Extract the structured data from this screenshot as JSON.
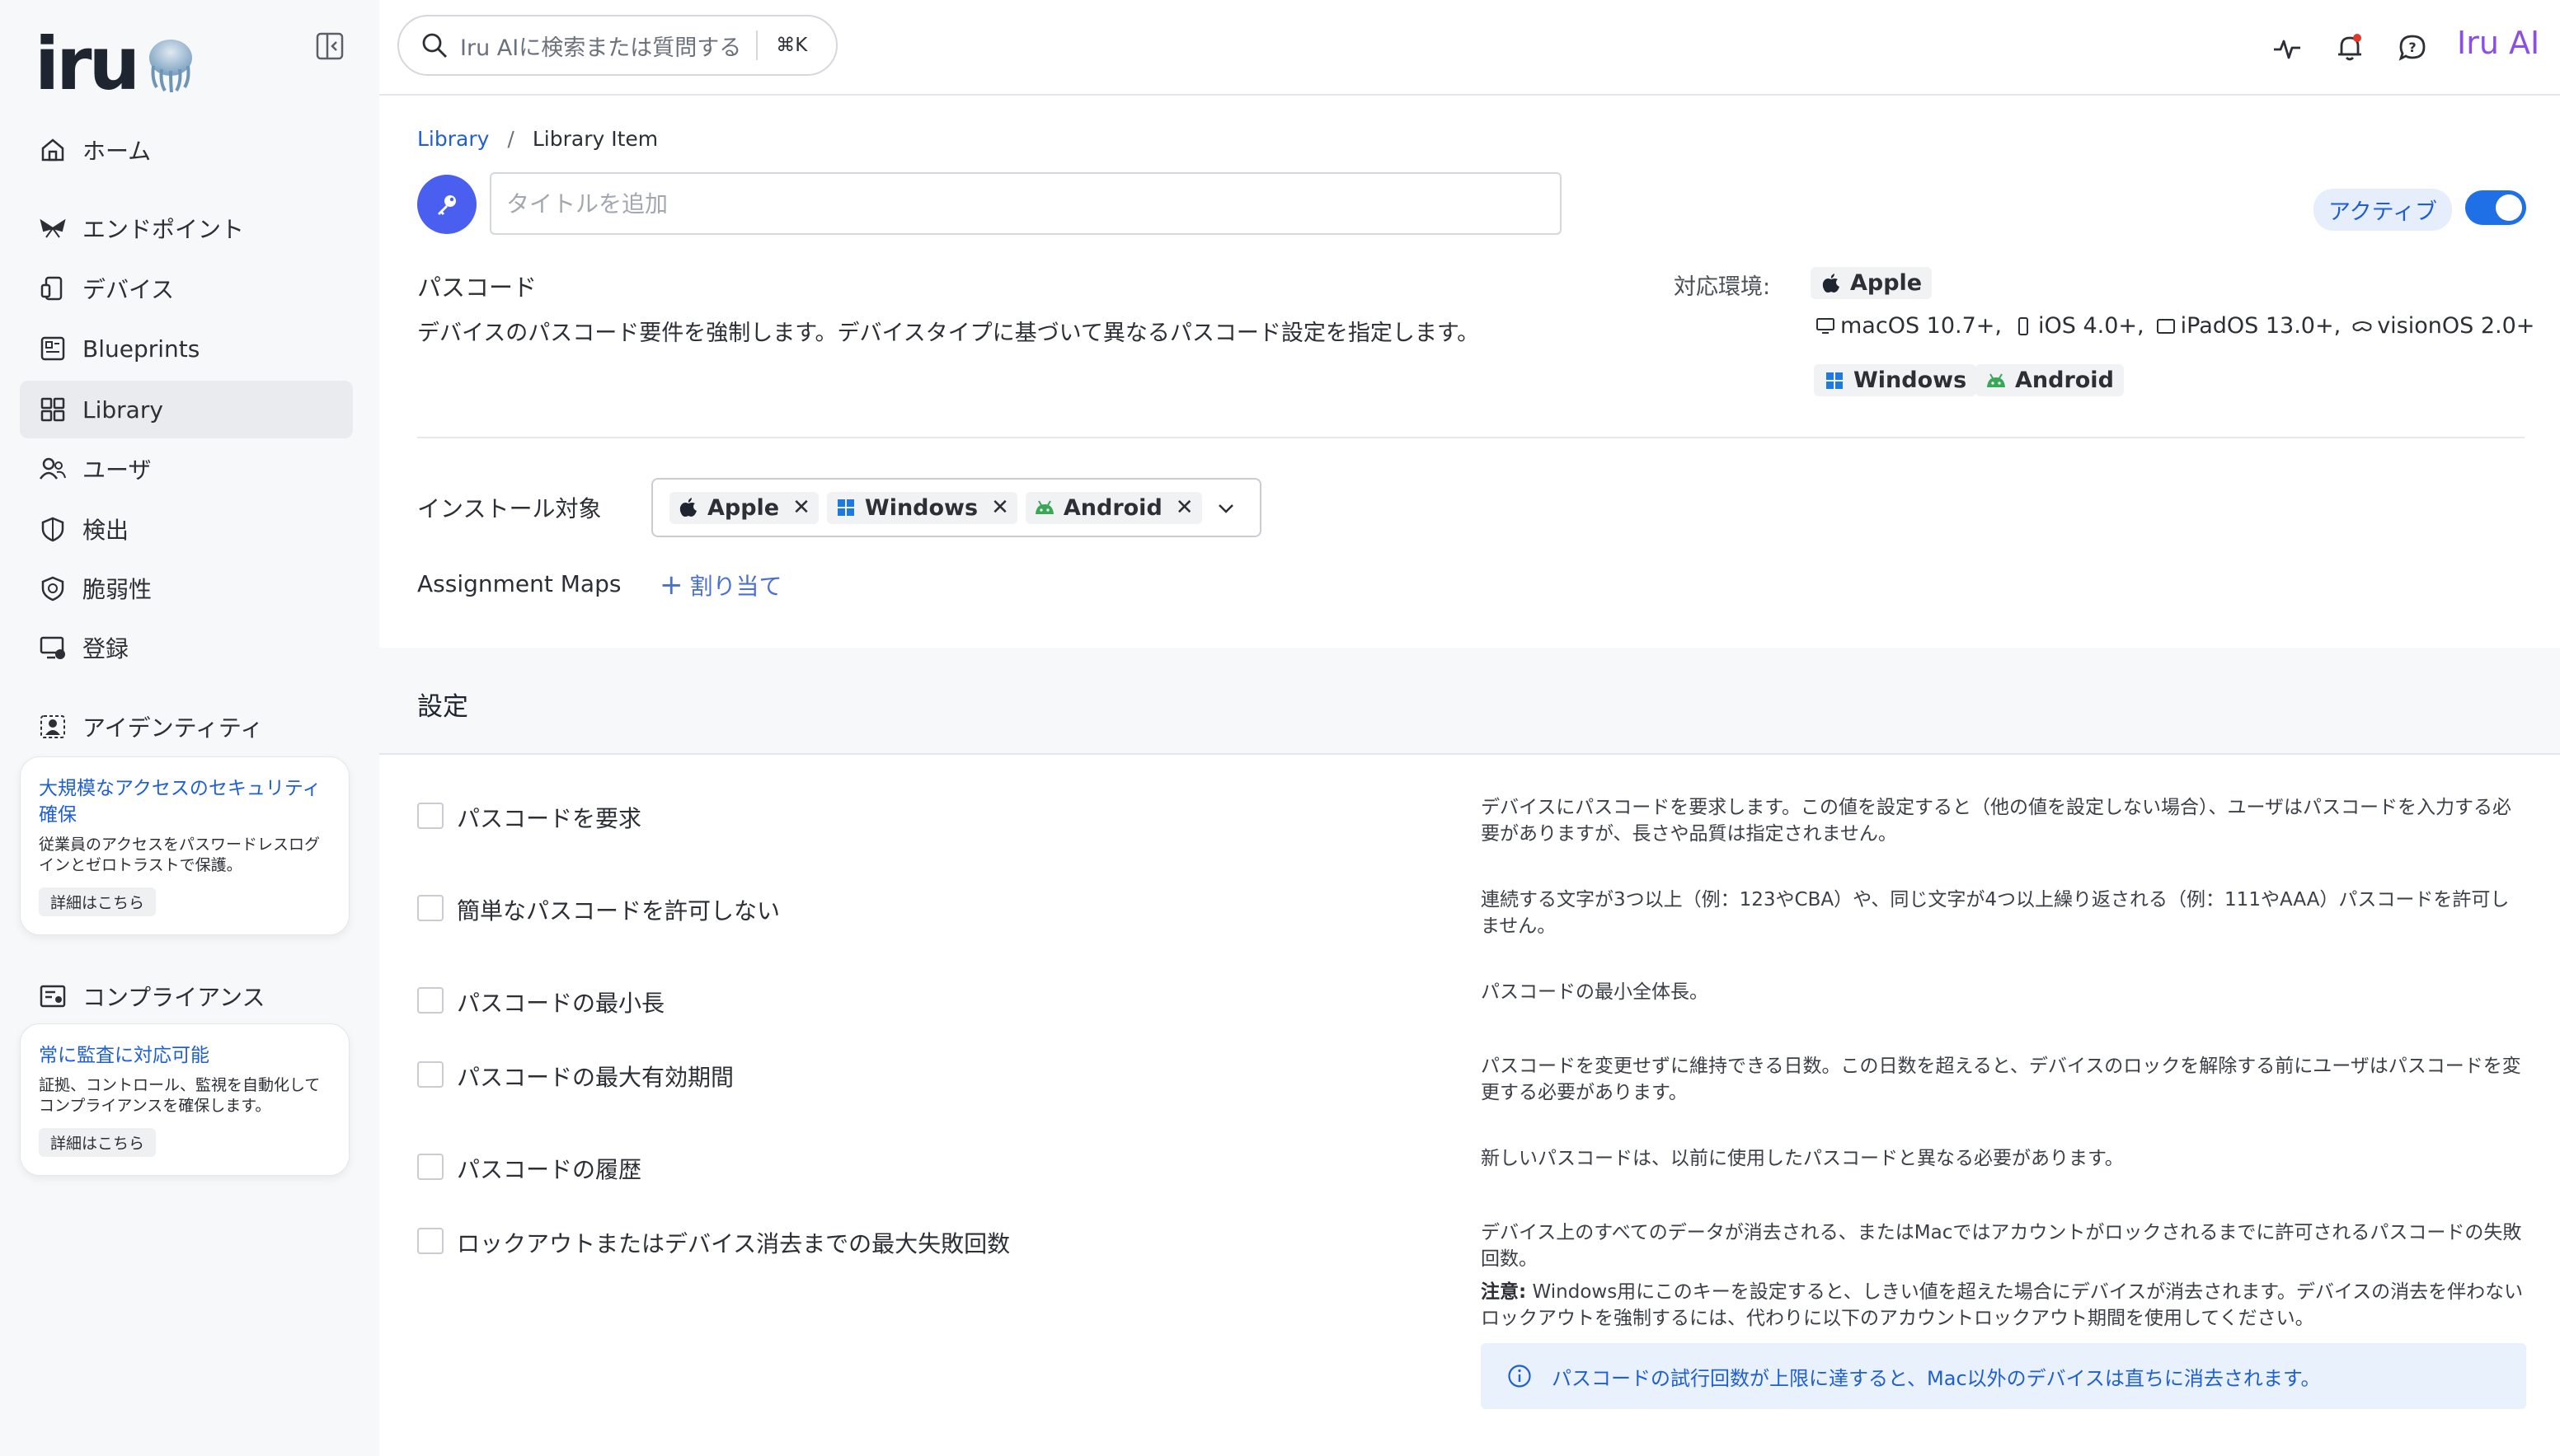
{
  "sidebar": {
    "logo_text": "iru",
    "items": [
      {
        "label": "ホーム",
        "icon": "home-icon"
      },
      {
        "label": "エンドポイント",
        "icon": "endpoint-icon"
      },
      {
        "label": "デバイス",
        "icon": "device-icon"
      },
      {
        "label": "Blueprints",
        "icon": "blueprint-icon"
      },
      {
        "label": "Library",
        "icon": "library-icon"
      },
      {
        "label": "ユーザ",
        "icon": "users-icon"
      },
      {
        "label": "検出",
        "icon": "shield-icon"
      },
      {
        "label": "脆弱性",
        "icon": "vulnerability-icon"
      },
      {
        "label": "登録",
        "icon": "enroll-icon"
      },
      {
        "label": "アイデンティティ",
        "icon": "identity-icon"
      },
      {
        "label": "コンプライアンス",
        "icon": "compliance-icon"
      }
    ],
    "promo1": {
      "title": "大規模なアクセスのセキュリティ確保",
      "desc": "従業員のアクセスをパスワードレスログインとゼロトラストで保護。",
      "button": "詳細はこちら"
    },
    "promo2": {
      "title": "常に監査に対応可能",
      "desc": "証拠、コントロール、監視を自動化してコンプライアンスを確保します。",
      "button": "詳細はこちら"
    }
  },
  "topbar": {
    "search_placeholder": "Iru AIに検索または質問する",
    "search_shortcut": "⌘K",
    "ai_label": "Iru AI"
  },
  "page": {
    "breadcrumb": {
      "root": "Library",
      "sep": "/",
      "current": "Library Item"
    },
    "title_placeholder": "タイトルを追加",
    "status": "アクティブ",
    "section_title": "パスコード",
    "section_desc": "デバイスのパスコード要件を強制します。デバイスタイプに基づいて異なるパスコード設定を指定します。",
    "compat_label": "対応環境:",
    "compat_apple": "Apple",
    "compat_windows": "Windows",
    "compat_android": "Android",
    "os_versions": [
      "macOS 10.7+,",
      "iOS 4.0+,",
      "iPadOS 13.0+,",
      "visionOS 2.0+"
    ],
    "install_label": "インストール対象",
    "install_tags": [
      "Apple",
      "Windows",
      "Android"
    ],
    "assignment_label": "Assignment Maps",
    "assign_button": "割り当て",
    "settings_title": "設定",
    "settings": [
      {
        "label": "パスコードを要求",
        "help": "デバイスにパスコードを要求します。この値を設定すると（他の値を設定しない場合）、ユーザはパスコードを入力する必要がありますが、長さや品質は指定されません。"
      },
      {
        "label": "簡単なパスコードを許可しない",
        "help": "連続する文字が3つ以上（例：123やCBA）や、同じ文字が4つ以上繰り返される（例：111やAAA）パスコードを許可しません。"
      },
      {
        "label": "パスコードの最小長",
        "help": "パスコードの最小全体長。"
      },
      {
        "label": "パスコードの最大有効期間",
        "help": "パスコードを変更せずに維持できる日数。この日数を超えると、デバイスのロックを解除する前にユーザはパスコードを変更する必要があります。"
      },
      {
        "label": "パスコードの履歴",
        "help": "新しいパスコードは、以前に使用したパスコードと異なる必要があります。"
      },
      {
        "label": "ロックアウトまたはデバイス消去までの最大失敗回数",
        "help": "デバイス上のすべてのデータが消去される、またはMacではアカウントがロックされるまでに許可されるパスコードの失敗回数。"
      }
    ],
    "note_label": "注意:",
    "note_text": " Windows用にこのキーを設定すると、しきい値を超えた場合にデバイスが消去されます。デバイスの消去を伴わないロックアウトを強制するには、代わりに以下のアカウントロックアウト期間を使用してください。",
    "info_text": "パスコードの試行回数が上限に達すると、Mac以外のデバイスは直ちに消去されます。"
  },
  "colors": {
    "accent": "#1f6fe6",
    "brand_purple": "#8c4fe6",
    "link": "#1f5fd6"
  }
}
